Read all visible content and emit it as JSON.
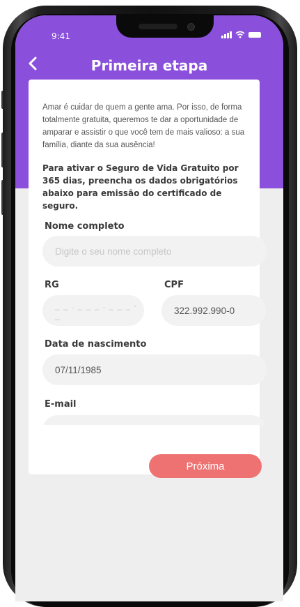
{
  "status_bar": {
    "time": "9:41"
  },
  "header": {
    "title": "Primeira etapa",
    "back_icon": "chevron-left-icon"
  },
  "intro_text": "Amar é cuidar de quem a gente ama. Por isso, de forma totalmente gratuita, queremos te dar a oportunidade de amparar e assistir o que você tem de mais valioso: a sua família, diante da sua ausência!",
  "notice_text": "Para ativar o Seguro de Vida Gratuito por 365 dias, preencha os dados obrigatórios abaixo para emissão do certificado de seguro.",
  "form": {
    "nome": {
      "label": "Nome completo",
      "placeholder": "Digite o seu nome completo",
      "value": ""
    },
    "rg": {
      "label": "RG",
      "placeholder": "_ _ . _ _ _ . _ _ _ - _",
      "value": ""
    },
    "cpf": {
      "label": "CPF",
      "value": "322.992.990-0"
    },
    "nascimento": {
      "label": "Data de nascimento",
      "value": "07/11/1985"
    },
    "email": {
      "label": "E-mail",
      "value": ""
    }
  },
  "next_button": {
    "label": "Próxima"
  },
  "colors": {
    "header": "#8a4fdb",
    "button": "#ee7272",
    "field_bg": "#f2f2f2",
    "screen_bg": "#eeeeee"
  }
}
